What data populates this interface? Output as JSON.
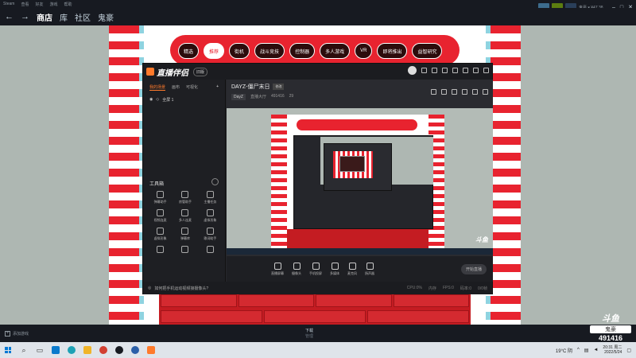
{
  "steam": {
    "menu": [
      "Steam",
      "查看",
      "好友",
      "游戏",
      "帮助"
    ],
    "nav": {
      "back": "←",
      "forward": "→",
      "store": "商店",
      "library": "库",
      "community": "社区",
      "user": "鬼豪"
    },
    "top_right_user": "鬼豪 ▾ ¥47.38",
    "add_game": "添加游戏",
    "downloads_label": "下载",
    "downloads_status": "管理"
  },
  "store": {
    "tabs": [
      "精选",
      "推荐",
      "街机",
      "战斗竞技",
      "控制器",
      "多人游戏",
      "VR",
      "即将推出",
      "益智研究"
    ],
    "selected_tab": 1
  },
  "live": {
    "app_name": "直播伴侣",
    "version": "旧版",
    "left_tabs": [
      "我的场景",
      "画布",
      "可视化"
    ],
    "scene_name": "全屏 1",
    "tools_title": "工具箱",
    "tools": [
      "弹幕助手",
      "房管助手",
      "主播任务",
      "视频连麦",
      "多人连麦",
      "虚拟形象",
      "虚拟形象",
      "弹幕库",
      "歌词助手",
      "",
      "",
      ""
    ],
    "room_title": "DAYZ-僵尸末日",
    "room_tag": "修改",
    "category": "DayZ",
    "room_meta_1": "直播大厅",
    "room_meta_2": "491416",
    "room_meta_3": "29",
    "controls": [
      "直播屏幕",
      "摄像头",
      "手机投屏",
      "多媒体",
      "麦克风",
      "扬声器"
    ],
    "start_button": "开始直播",
    "status_left": "如何把手机运动视频接摄像头?",
    "status_right": [
      "CPU:0%",
      "内存",
      "FPS:0",
      "码率:0",
      "0/0帧"
    ]
  },
  "watermark": {
    "logo": "斗鱼",
    "name": "鬼豪",
    "room_id": "491416"
  },
  "taskbar": {
    "search_icon": "⌕",
    "weather": "19°C 阴",
    "time": "20:31 周二",
    "date": "2022/5/24"
  }
}
